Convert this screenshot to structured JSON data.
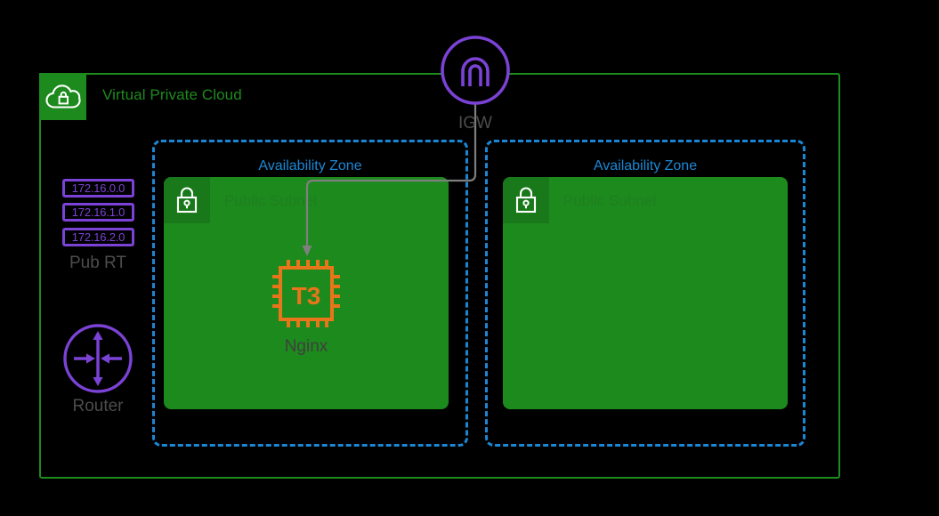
{
  "diagram": {
    "vpc": {
      "title": "Virtual Private Cloud",
      "icon": "vpc-cloud-lock-icon",
      "border_color": "#1D8A1D"
    },
    "igw": {
      "label": "IGW",
      "icon": "internet-gateway-icon",
      "color": "#7B42D6"
    },
    "route_table": {
      "label": "Pub RT",
      "entries": [
        "172.16.0.0",
        "172.16.1.0",
        "172.16.2.0"
      ],
      "color": "#7B42D6"
    },
    "router": {
      "label": "Router",
      "icon": "router-icon",
      "color": "#7B42D6"
    },
    "availability_zones": [
      {
        "label": "Availability Zone",
        "border_color": "#1B87D4",
        "subnet": {
          "label": "Public Subnet",
          "icon": "subnet-lock-icon",
          "fill_color": "#1D8A1D"
        },
        "instance": {
          "type": "T3",
          "label": "Nginx",
          "icon": "ec2-instance-icon",
          "color": "#E8751A"
        }
      },
      {
        "label": "Availability Zone",
        "border_color": "#1B87D4",
        "subnet": {
          "label": "Public Subnet",
          "icon": "subnet-lock-icon",
          "fill_color": "#1D8A1D"
        }
      }
    ],
    "connector": {
      "from": "IGW",
      "to": "T3",
      "color": "#7F7F7F"
    }
  }
}
